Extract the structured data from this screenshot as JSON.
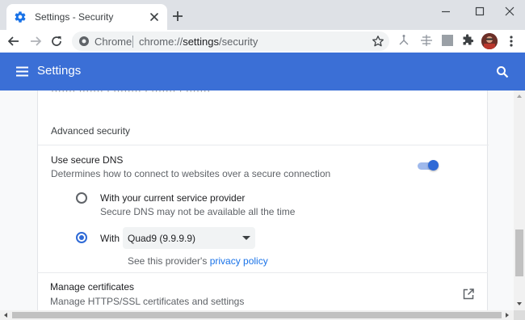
{
  "window": {
    "tab_title": "Settings - Security"
  },
  "toolbar": {
    "site_chip": "Chrome",
    "url_scheme": "chrome://",
    "url_host": "settings",
    "url_path": "/security"
  },
  "header": {
    "title": "Settings"
  },
  "content": {
    "clipped_text": "·······  ·······  ·  ········  ·  ·······  ·  ·······"
  },
  "advanced_security": {
    "section_title": "Advanced security",
    "secure_dns": {
      "title": "Use secure DNS",
      "description": "Determines how to connect to websites over a secure connection",
      "enabled": true,
      "option_current_provider": {
        "title": "With your current service provider",
        "description": "Secure DNS may not be available all the time",
        "selected": false
      },
      "option_custom": {
        "label": "With",
        "selected": true,
        "provider_selected": "Quad9 (9.9.9.9)"
      },
      "provider_note_prefix": "See this provider's",
      "provider_note_link": "privacy policy"
    },
    "manage_certificates": {
      "title": "Manage certificates",
      "description": "Manage HTTPS/SSL certificates and settings"
    }
  },
  "colors": {
    "accent": "#2f6ad6",
    "header_bg": "#3b6fd6",
    "link": "#1a73e8"
  },
  "icons": {
    "favicon": "gear-icon",
    "header_menu": "hamburger-icon",
    "header_search": "search-icon",
    "open_external": "open-in-new-icon"
  }
}
